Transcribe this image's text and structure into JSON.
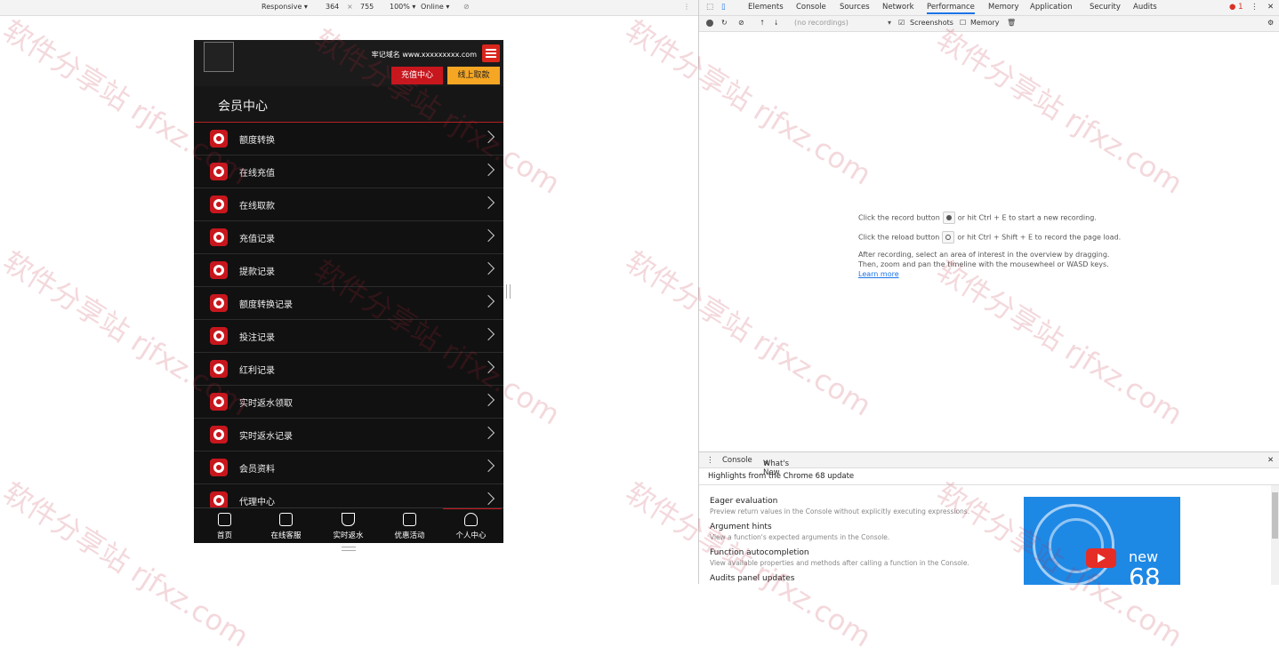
{
  "emulation": {
    "device": "Responsive ▾",
    "width": "364",
    "times": "×",
    "height": "755",
    "zoom": "100% ▾",
    "network": "Online ▾"
  },
  "device": {
    "domain_label": "牢记域名 www.xxxxxxxxx.com",
    "recharge_button": "充值中心",
    "withdraw_button": "线上取款",
    "page_title": "会员中心",
    "menu_items": [
      {
        "label": "额度转换"
      },
      {
        "label": "在线充值"
      },
      {
        "label": "在线取款"
      },
      {
        "label": "充值记录"
      },
      {
        "label": "提款记录"
      },
      {
        "label": "额度转换记录"
      },
      {
        "label": "投注记录"
      },
      {
        "label": "红利记录"
      },
      {
        "label": "实时返水领取"
      },
      {
        "label": "实时返水记录"
      },
      {
        "label": "会员资料"
      },
      {
        "label": "代理中心"
      }
    ],
    "tabbar": [
      {
        "label": "首页",
        "icon": "home-icon"
      },
      {
        "label": "在线客服",
        "icon": "chat-icon"
      },
      {
        "label": "实时返水",
        "icon": "trophy-icon"
      },
      {
        "label": "优惠活动",
        "icon": "gift-icon"
      },
      {
        "label": "个人中心",
        "icon": "user-icon",
        "active": true
      }
    ]
  },
  "devtools": {
    "tabs": [
      "Elements",
      "Console",
      "Sources",
      "Network",
      "Performance",
      "Memory",
      "Application",
      "Security",
      "Audits"
    ],
    "active_tab": "Performance",
    "error_count": "1",
    "toolbar": {
      "profile_select": "(no recordings)",
      "screenshots_label": "Screenshots",
      "memory_label": "Memory"
    },
    "perf": {
      "line1_a": "Click the record button",
      "line1_b": "or hit Ctrl + E to start a new recording.",
      "line2_a": "Click the reload button",
      "line2_b": "or hit Ctrl + Shift + E to record the page load.",
      "line3": "After recording, select an area of interest in the overview by dragging.",
      "line4": "Then, zoom and pan the timeline with the mousewheel or WASD keys.",
      "learn_more": "Learn more"
    },
    "drawer": {
      "tabs": [
        "Console",
        "What's New"
      ],
      "heading": "Highlights from the Chrome 68 update",
      "features": [
        {
          "title": "Eager evaluation",
          "desc": "Preview return values in the Console without explicitly executing expressions."
        },
        {
          "title": "Argument hints",
          "desc": "View a function's expected arguments in the Console."
        },
        {
          "title": "Function autocompletion",
          "desc": "View available properties and methods after calling a function in the Console."
        },
        {
          "title": "Audits panel updates",
          "desc": ""
        }
      ],
      "video_new": "new",
      "video_num": "68"
    }
  },
  "watermark": "软件分享站 rjfxz.com",
  "colors": {
    "accent_red": "#c8161d",
    "accent_orange": "#f5a623",
    "devtools_blue": "#1a73e8"
  }
}
